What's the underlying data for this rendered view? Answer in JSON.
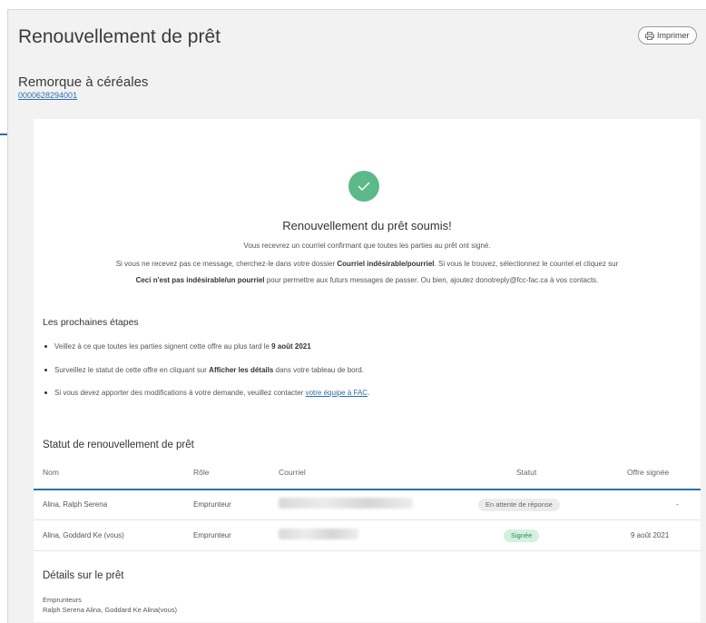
{
  "page": {
    "title": "Renouvellement de prêt",
    "print_label": "Imprimer",
    "subtitle": "Remorque à céréales",
    "loan_number": "0000628294001"
  },
  "confirmation": {
    "heading": "Renouvellement du prêt soumis!",
    "line1": "Vous recevrez un courriel confirmant que toutes les parties au prêt ont signé.",
    "line2_pre": "Si vous ne recevez pas ce message, cherchez-le dans votre dossier ",
    "line2_bold": "Courriel indésirable/pourriel",
    "line2_post": ". Si vous le trouvez, sélectionnez le courriel et cliquez sur",
    "line3_bold": "Ceci n'est pas indésirable/un pourriel",
    "line3_post": " pour permettre aux futurs messages de passer. Ou bien, ajoutez donotreply@fcc-fac.ca à vos contacts."
  },
  "next_steps": {
    "heading": "Les prochaines étapes",
    "b1_pre": "Veillez à ce que toutes les parties signent cette offre au plus tard le ",
    "b1_bold": "9 août 2021",
    "b2_pre": "Surveillez le statut de cette offre en cliquant sur ",
    "b2_bold": "Afficher les détails",
    "b2_post": " dans votre tableau de bord.",
    "b3_pre": "Si vous devez apporter des modifications à votre demande, veuillez contacter ",
    "b3_link": "votre équipe à FAC",
    "b3_post": "."
  },
  "status_table": {
    "heading": "Statut de renouvellement de prêt",
    "columns": [
      "Nom",
      "Rôle",
      "Courriel",
      "Statut",
      "Offre signée"
    ],
    "rows": [
      {
        "name": "Alina, Ralph Serena",
        "role": "Emprunteur",
        "status": "En attente de réponse",
        "signed": "-"
      },
      {
        "name": "Alina, Goddard Ke (vous)",
        "role": "Emprunteur",
        "status": "Signée",
        "signed": "9 août 2021"
      }
    ]
  },
  "details": {
    "heading": "Détails sur le prêt",
    "borrowers_label": "Emprunteurs",
    "borrowers_value": "Ralph Serena Alina, Goddard Ke Alina(vous)"
  },
  "colors": {
    "accent": "#2a6fb0",
    "success": "#5cb98a",
    "signed_badge_bg": "#d4f0de",
    "pending_badge_bg": "#ececec"
  },
  "icons": {
    "arrow": "arrow-right-icon",
    "check": "check-icon",
    "print": "printer-icon"
  }
}
